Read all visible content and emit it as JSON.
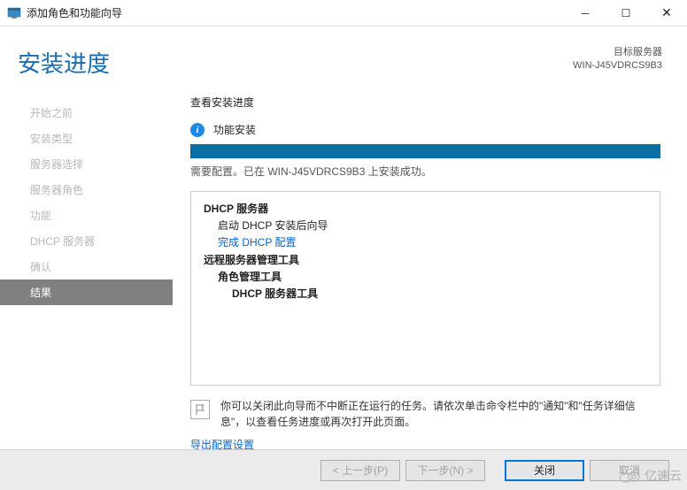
{
  "titlebar": {
    "title": "添加角色和功能向导"
  },
  "header": {
    "title": "安装进度",
    "target_label": "目标服务器",
    "target_server": "WIN-J45VDRCS9B3"
  },
  "nav": {
    "items": [
      {
        "label": "开始之前"
      },
      {
        "label": "安装类型"
      },
      {
        "label": "服务器选择"
      },
      {
        "label": "服务器角色"
      },
      {
        "label": "功能"
      },
      {
        "label": "DHCP 服务器"
      },
      {
        "label": "确认"
      },
      {
        "label": "结果"
      }
    ]
  },
  "main": {
    "progress_label": "查看安装进度",
    "status_heading": "功能安装",
    "status_text": "需要配置。已在 WIN-J45VDRCS9B3 上安装成功。",
    "results": {
      "dhcp_server": "DHCP 服务器",
      "launch_wizard": "启动 DHCP 安装后向导",
      "complete_config": "完成 DHCP 配置",
      "rsat": "远程服务器管理工具",
      "role_tools": "角色管理工具",
      "dhcp_tools": "DHCP 服务器工具"
    },
    "hint": "你可以关闭此向导而不中断正在运行的任务。请依次单击命令栏中的\"通知\"和\"任务详细信息\"，以查看任务进度或再次打开此页面。",
    "export_link": "导出配置设置"
  },
  "footer": {
    "prev": "< 上一步(P)",
    "next": "下一步(N) >",
    "close": "关闭",
    "cancel": "取消"
  },
  "watermark": {
    "text": "亿速云"
  }
}
